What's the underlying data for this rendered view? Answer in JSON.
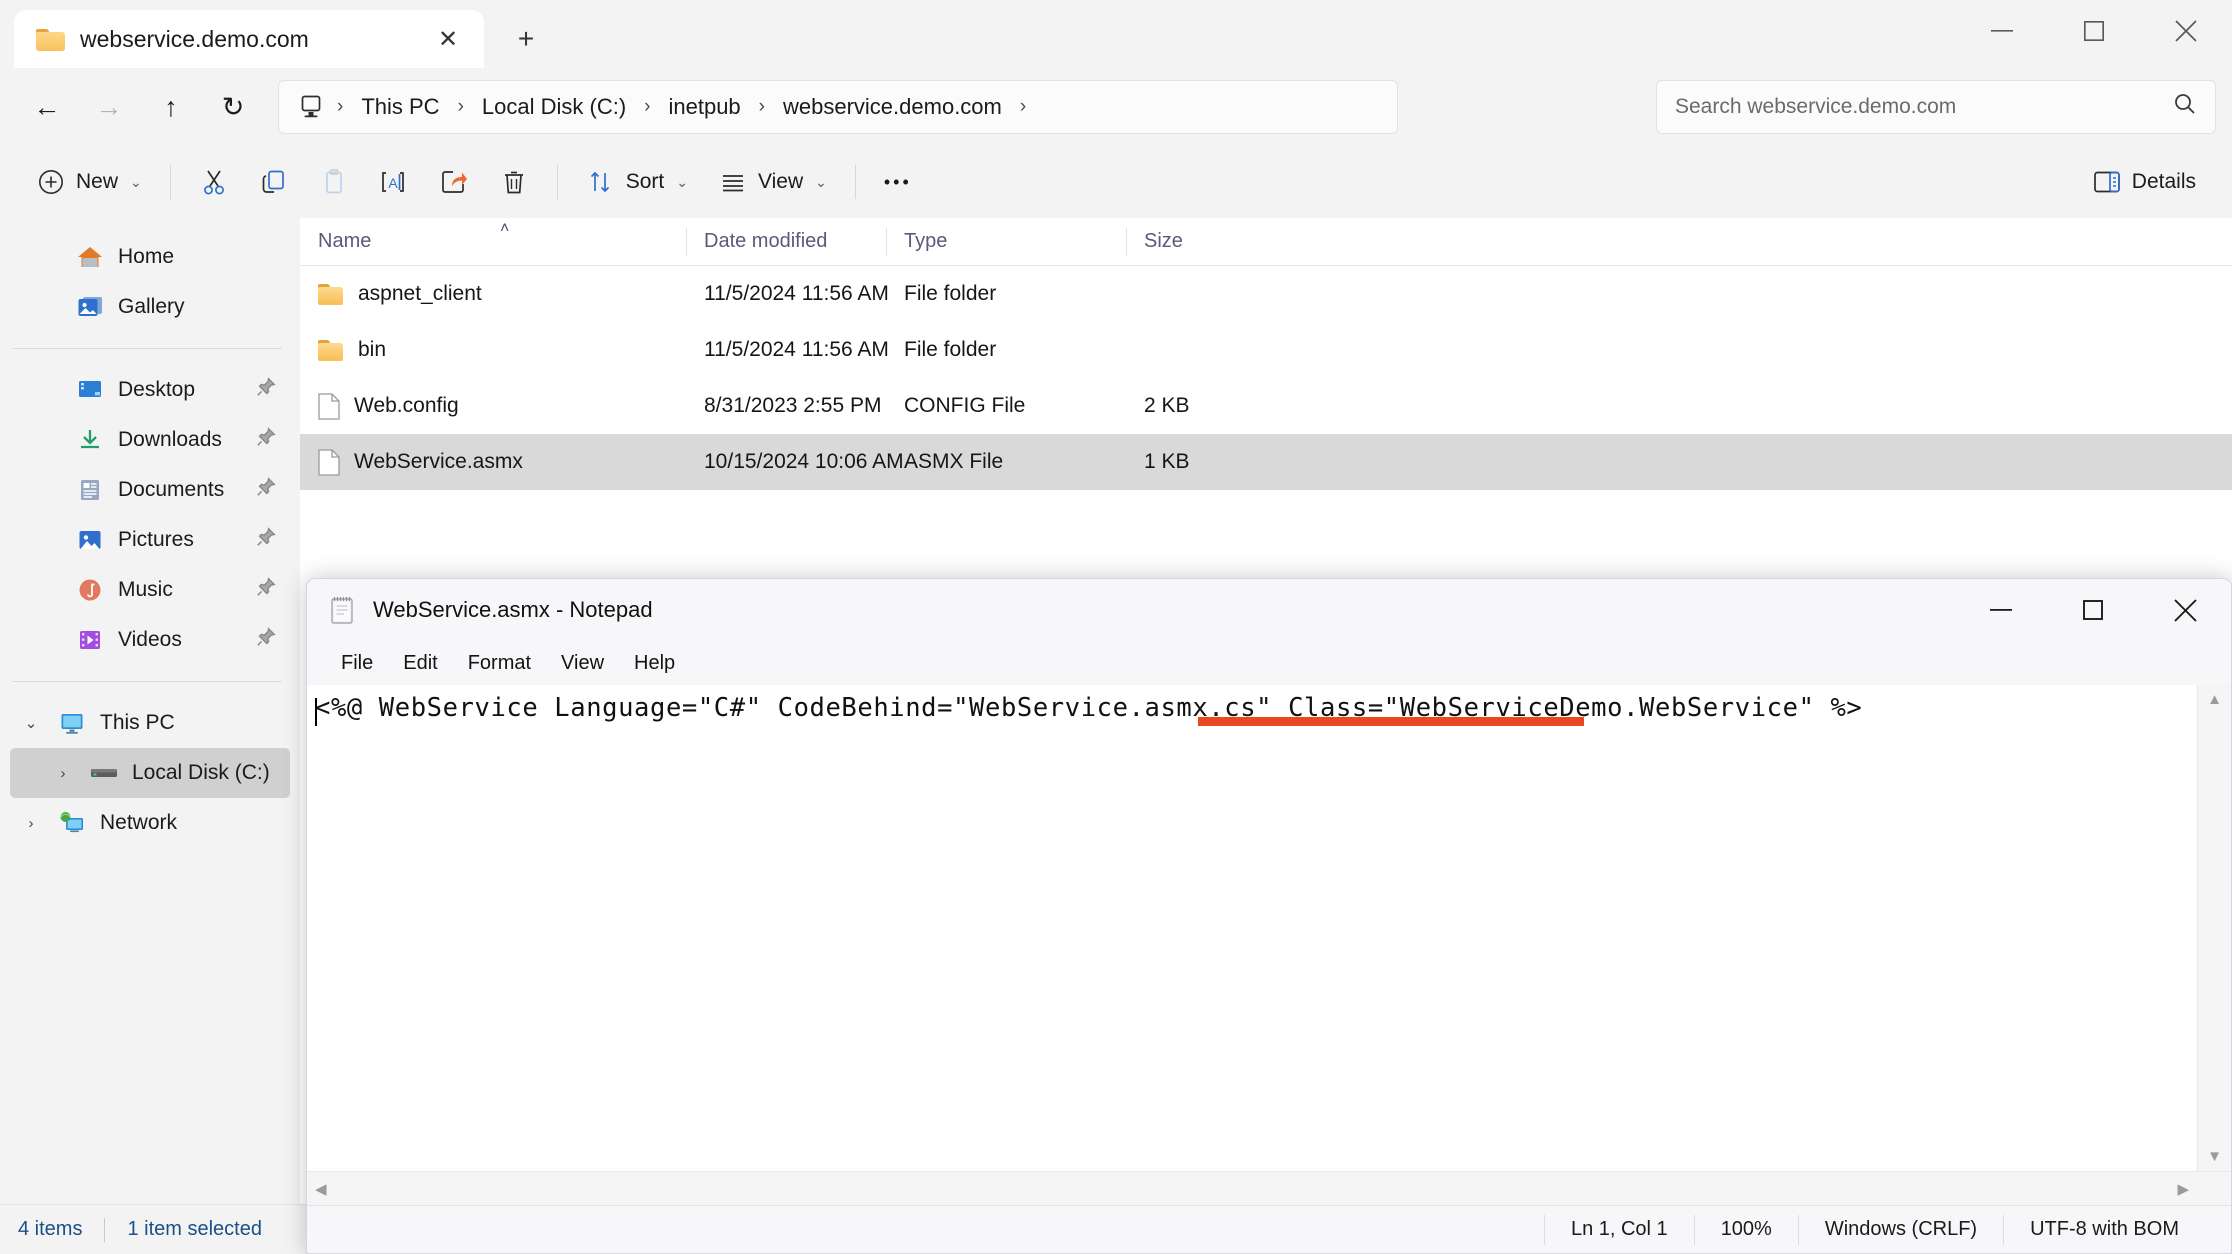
{
  "explorer": {
    "tab": {
      "title": "webservice.demo.com",
      "close_label": "✕",
      "new_tab_label": "+"
    },
    "window_controls": {
      "minimize": "—",
      "maximize": "□",
      "close": "✕"
    },
    "nav": {
      "back": "←",
      "forward": "→",
      "up": "↑",
      "refresh": "↻"
    },
    "breadcrumb": {
      "items": [
        "This PC",
        "Local Disk (C:)",
        "inetpub",
        "webservice.demo.com"
      ],
      "separator": "›"
    },
    "search": {
      "placeholder": "Search webservice.demo.com",
      "value": "",
      "icon": "search-icon"
    },
    "commandbar": {
      "new_label": "New",
      "cut_label": "Cut",
      "copy_label": "Copy",
      "paste_label": "Paste",
      "rename_label": "Rename",
      "share_label": "Share",
      "delete_label": "Delete",
      "sort_label": "Sort",
      "view_label": "View",
      "more_label": "•••",
      "details_label": "Details",
      "chevron": "⌄"
    },
    "sidebar": {
      "quick": [
        {
          "label": "Home",
          "icon": "home-icon",
          "pinned": false
        },
        {
          "label": "Gallery",
          "icon": "gallery-icon",
          "pinned": false
        }
      ],
      "pinned": [
        {
          "label": "Desktop",
          "icon": "desktop-icon",
          "pinned": true
        },
        {
          "label": "Downloads",
          "icon": "downloads-icon",
          "pinned": true
        },
        {
          "label": "Documents",
          "icon": "documents-icon",
          "pinned": true
        },
        {
          "label": "Pictures",
          "icon": "pictures-icon",
          "pinned": true
        },
        {
          "label": "Music",
          "icon": "music-icon",
          "pinned": true
        },
        {
          "label": "Videos",
          "icon": "videos-icon",
          "pinned": true
        }
      ],
      "tree": [
        {
          "label": "This PC",
          "icon": "this-pc-icon",
          "expander": "⌄",
          "expanded": true,
          "selected": false,
          "indent": 0
        },
        {
          "label": "Local Disk (C:)",
          "icon": "drive-icon",
          "expander": "›",
          "expanded": false,
          "selected": true,
          "indent": 1
        },
        {
          "label": "Network",
          "icon": "network-icon",
          "expander": "›",
          "expanded": false,
          "selected": false,
          "indent": 0
        }
      ],
      "pin_glyph": "📌"
    },
    "columns": {
      "name": "Name",
      "date_modified": "Date modified",
      "type": "Type",
      "size": "Size",
      "sort_indicator": "˄"
    },
    "files": [
      {
        "name": "aspnet_client",
        "date": "11/5/2024 11:56 AM",
        "type": "File folder",
        "size": "",
        "kind": "folder",
        "selected": false
      },
      {
        "name": "bin",
        "date": "11/5/2024 11:56 AM",
        "type": "File folder",
        "size": "",
        "kind": "folder",
        "selected": false
      },
      {
        "name": "Web.config",
        "date": "8/31/2023 2:55 PM",
        "type": "CONFIG File",
        "size": "2 KB",
        "kind": "file",
        "selected": false
      },
      {
        "name": "WebService.asmx",
        "date": "10/15/2024 10:06 AM",
        "type": "ASMX File",
        "size": "1 KB",
        "kind": "file",
        "selected": true
      }
    ],
    "statusbar": {
      "item_count": "4 items",
      "selection": "1 item selected"
    }
  },
  "notepad": {
    "title": "WebService.asmx - Notepad",
    "window_controls": {
      "minimize": "—",
      "maximize": "□",
      "close": "✕"
    },
    "menu": [
      "File",
      "Edit",
      "Format",
      "View",
      "Help"
    ],
    "content": "<%@ WebService Language=\"C#\" CodeBehind=\"WebService.asmx.cs\" Class=\"WebServiceDemo.WebService\" %>",
    "annotation": {
      "type": "underline",
      "color": "#e8491f",
      "targets": "Class=\"WebServiceDemo.WebService\""
    },
    "scroll": {
      "up": "▲",
      "down": "▼",
      "left": "◀",
      "right": "▶"
    },
    "statusbar": {
      "position": "Ln 1, Col 1",
      "zoom": "100%",
      "line_endings": "Windows (CRLF)",
      "encoding": "UTF-8 with BOM"
    }
  }
}
